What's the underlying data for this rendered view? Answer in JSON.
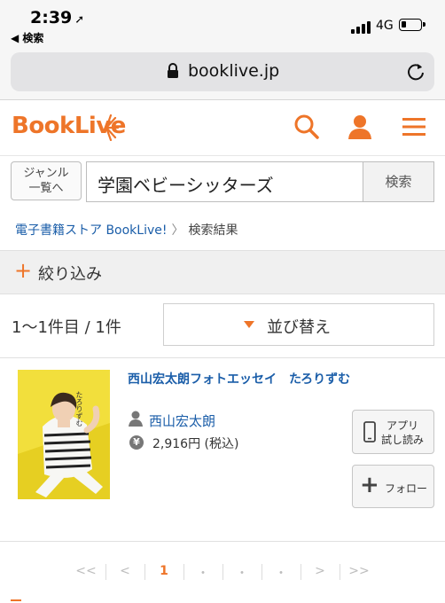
{
  "status_bar": {
    "time": "2:39",
    "location_arrow": "➚",
    "back_label": "◀ 検索",
    "network": "4G"
  },
  "browser": {
    "url": "booklive.jp"
  },
  "header": {
    "logo_text": "BookLive",
    "icons": [
      "search-icon",
      "user-icon",
      "menu-icon"
    ],
    "accent_color": "#ee7529"
  },
  "search": {
    "genre_button_line1": "ジャンル",
    "genre_button_line2": "一覧へ",
    "query": "学園ベビーシッターズ",
    "submit_label": "検索"
  },
  "breadcrumb": {
    "store_link": "電子書籍ストア BookLive!",
    "separator": "〉",
    "current": "検索結果"
  },
  "filter": {
    "plus": "+",
    "label": "絞り込み"
  },
  "results": {
    "count_text": "1〜1件目 / 1件",
    "sort_label": "並び替え",
    "items": [
      {
        "title": "西山宏太朗フォトエッセイ　たろりずむ",
        "author": "西山宏太朗",
        "price": "2,916円 (税込)",
        "yen_symbol": "¥",
        "trial_line1": "アプリ",
        "trial_line2": "試し読み",
        "follow_plus": "+",
        "follow_label": "フォロー",
        "cover_text": "たろりずむ"
      }
    ]
  },
  "pagination": {
    "items": [
      "<<",
      "<",
      "1",
      "・",
      "・",
      "・",
      ">",
      ">>"
    ],
    "current_index": 2
  }
}
